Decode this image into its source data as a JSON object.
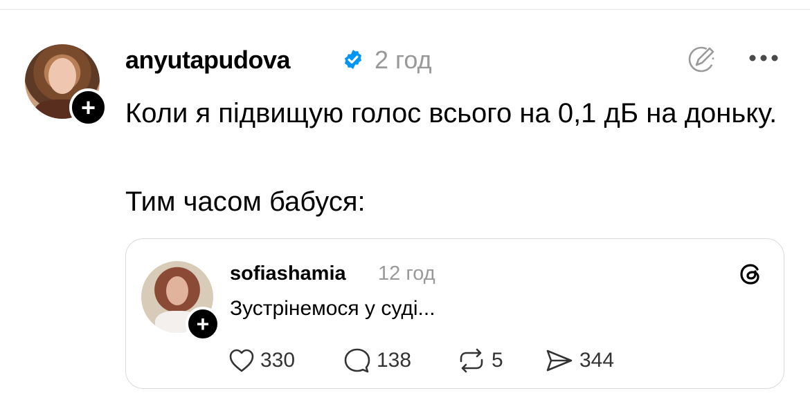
{
  "post": {
    "username": "anyutapudova",
    "time": "2 год",
    "text_line1": "Коли я підвищую голос всього на 0,1 дБ на доньку.",
    "text_line2": "Тим часом бабуся:"
  },
  "quote": {
    "username": "sofiashamia",
    "time": "12 год",
    "text": "Зустрінемося у суді...",
    "stats": {
      "likes": "330",
      "comments": "138",
      "reposts": "5",
      "shares": "344"
    }
  },
  "icons": {
    "verified": "verified-badge-icon",
    "edit": "edit-icon",
    "more": "more-icon",
    "threads": "threads-logo-icon",
    "like": "heart-icon",
    "comment": "comment-icon",
    "repost": "repost-icon",
    "share": "share-icon",
    "plus": "plus-icon"
  },
  "colors": {
    "verified_blue": "#0095f6",
    "muted_text": "#999999",
    "border": "#dadada"
  }
}
